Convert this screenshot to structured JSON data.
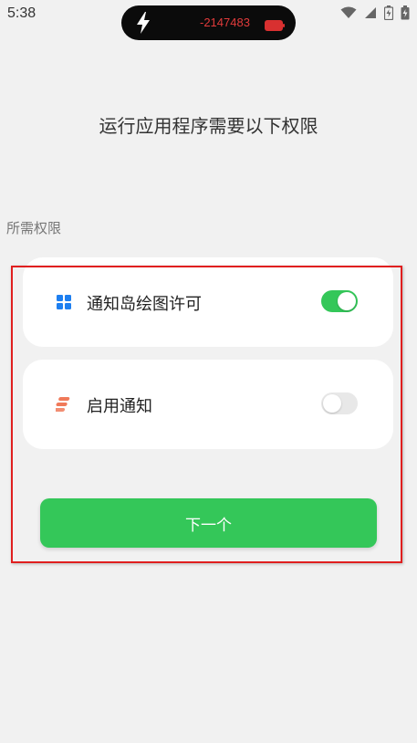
{
  "status_bar": {
    "time": "5:38",
    "icons": [
      "wifi-icon",
      "signal-icon",
      "battery-icon",
      "charging-icon"
    ]
  },
  "island": {
    "icon": "bolt-icon",
    "value": "-2147483",
    "value_color": "#e23b3b",
    "battery_color": "#d83030"
  },
  "page": {
    "title": "运行应用程序需要以下权限",
    "section_label": "所需权限"
  },
  "permissions": [
    {
      "label": "通知岛绘图许可",
      "icon": "grid-icon",
      "icon_color": "#1e7ff0",
      "enabled": true
    },
    {
      "label": "启用通知",
      "icon": "notification-stack-icon",
      "icon_color": "#f07a5a",
      "enabled": false
    }
  ],
  "next_button": {
    "label": "下一个"
  },
  "colors": {
    "accent": "#34c759",
    "highlight_frame": "#e01f1f",
    "background": "#f1f1f1"
  }
}
